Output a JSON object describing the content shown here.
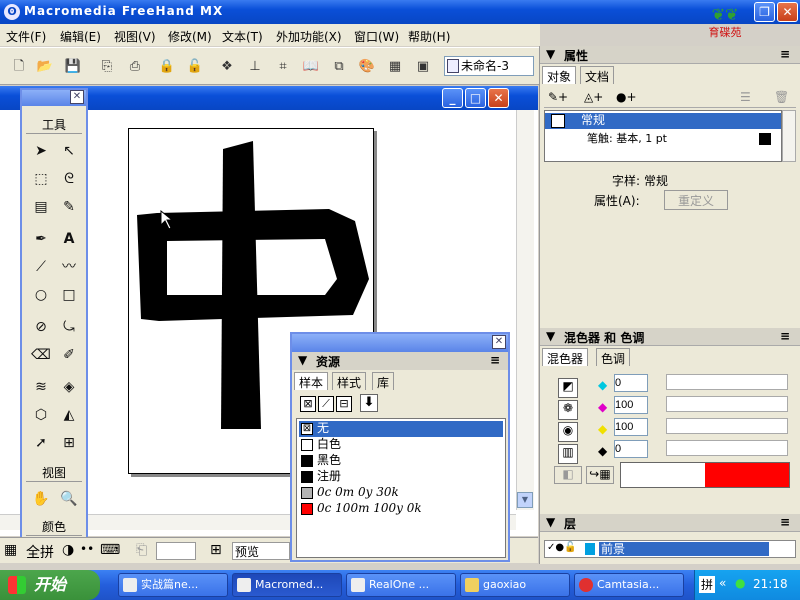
{
  "app_title": "Macromedia FreeHand MX",
  "logo_text": "育碟苑",
  "menu": [
    "文件(F)",
    "编辑(E)",
    "视图(V)",
    "修改(M)",
    "文本(T)",
    "外加功能(X)",
    "窗口(W)",
    "帮助(H)"
  ],
  "document_name": "未命名-3",
  "tools_panel": {
    "section_tools": "工具",
    "section_view": "视图",
    "section_colors": "颜色"
  },
  "doc_status": {
    "full_label": "全拼",
    "preview_label": "预览"
  },
  "properties_panel": {
    "title": "属性",
    "tabs": [
      "对象",
      "文档"
    ],
    "list": [
      {
        "label": "常规",
        "selected": true
      },
      {
        "label": "笔触: 基本, 1 pt",
        "selected": false
      }
    ],
    "style_label": "字样:",
    "style_value": "常规",
    "attr_label": "属性(A):",
    "redefine_button": "重定义"
  },
  "mixer_panel": {
    "title": "混色器 和 色调",
    "tabs": [
      "混色器",
      "色调"
    ],
    "channels": [
      {
        "value": "0",
        "color": "#00c8e0"
      },
      {
        "value": "100",
        "color": "#e000c8"
      },
      {
        "value": "100",
        "color": "#f0e000"
      },
      {
        "value": "0",
        "color": "#000000"
      }
    ],
    "preview_color": "#ff0000"
  },
  "layers_panel": {
    "title": "层",
    "layer_name": "前景"
  },
  "assets_panel": {
    "title": "资源",
    "tabs": [
      "样本",
      "样式",
      "库"
    ],
    "swatches": [
      {
        "label": "无",
        "color": "none",
        "selected": true,
        "italic": false
      },
      {
        "label": "白色",
        "color": "#ffffff",
        "selected": false,
        "italic": false
      },
      {
        "label": "黑色",
        "color": "#000000",
        "selected": false,
        "italic": false
      },
      {
        "label": "注册",
        "color": "#000000",
        "selected": false,
        "italic": false
      },
      {
        "label": "0c 0m 0y 30k",
        "color": "#b3b3b3",
        "selected": false,
        "italic": true
      },
      {
        "label": "0c 100m 100y 0k",
        "color": "#ff0000",
        "selected": false,
        "italic": true
      }
    ]
  },
  "canvas": {
    "glyph": "中"
  },
  "taskbar": {
    "start_label": "开始",
    "tasks": [
      "实战篇ne...",
      "Macromed...",
      "RealOne ...",
      "gaoxiao",
      "Camtasia..."
    ],
    "clock": "21:18",
    "ime_label": "拼"
  }
}
